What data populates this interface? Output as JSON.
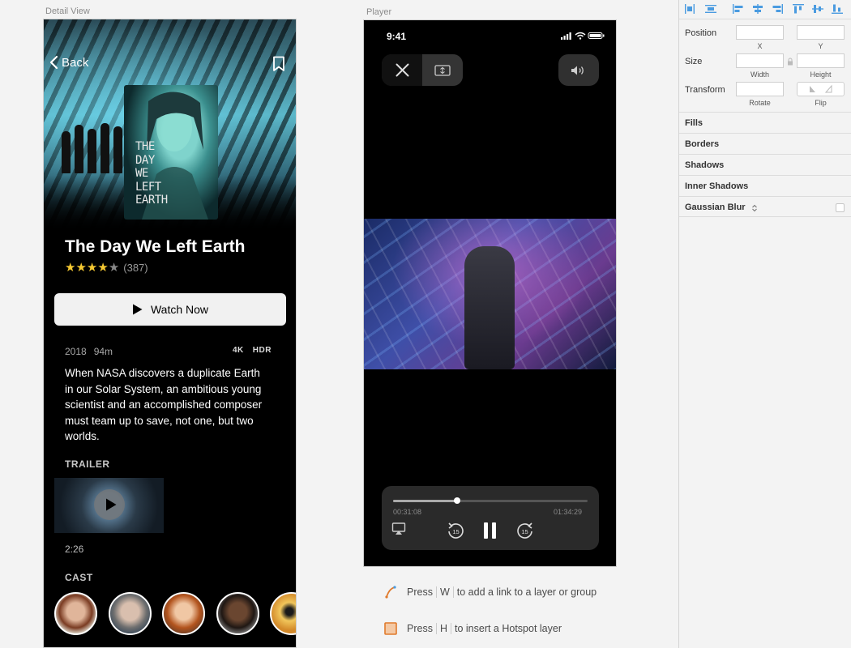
{
  "artboards": {
    "detail_label": "Detail View",
    "player_label": "Player"
  },
  "detail": {
    "back_label": "Back",
    "poster_title": "THE\nDAY\nWE\nLEFT\nEARTH",
    "movie_title": "The Day We Left Earth",
    "rating": {
      "stars_filled": 4,
      "stars_total": 5,
      "count": "(387)"
    },
    "watch_button": "Watch Now",
    "year": "2018",
    "runtime": "94m",
    "badges": [
      "4K",
      "HDR"
    ],
    "synopsis": "When NASA discovers a duplicate Earth in our Solar System, an ambitious young scientist and an accomplished composer must team up to save, not one, but two worlds.",
    "trailer_heading": "TRAILER",
    "trailer_duration": "2:26",
    "cast_heading": "CAST"
  },
  "player": {
    "status_time": "9:41",
    "elapsed": "00:31:08",
    "remaining": "01:34:29",
    "progress_fraction": 0.33,
    "skip_back_seconds": "15",
    "skip_forward_seconds": "15"
  },
  "hints": [
    {
      "prefix": "Press",
      "key": "W",
      "suffix": "to add a link to a layer or group"
    },
    {
      "prefix": "Press",
      "key": "H",
      "suffix": "to insert a Hotspot layer"
    }
  ],
  "inspector": {
    "position_label": "Position",
    "x_label": "X",
    "y_label": "Y",
    "size_label": "Size",
    "width_label": "Width",
    "height_label": "Height",
    "transform_label": "Transform",
    "rotate_label": "Rotate",
    "flip_label": "Flip",
    "sections": [
      "Fills",
      "Borders",
      "Shadows",
      "Inner Shadows",
      "Gaussian Blur"
    ]
  },
  "colors": {
    "star": "#f6c932",
    "accent_blue": "#4a9be0",
    "hotspot_orange": "#e07a2c"
  }
}
